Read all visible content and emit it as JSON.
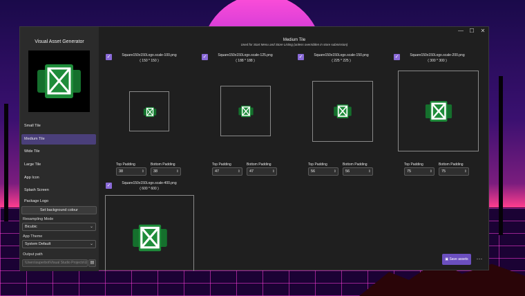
{
  "app": {
    "title": "Visual Asset Generator"
  },
  "window_controls": {
    "minimize": "—",
    "maximize": "☐",
    "close": "✕"
  },
  "sidebar": {
    "items": [
      {
        "label": "Small Tile"
      },
      {
        "label": "Medium Tile"
      },
      {
        "label": "Wide Tile"
      },
      {
        "label": "Large Tile"
      },
      {
        "label": "App Icon"
      },
      {
        "label": "Splash Screen"
      },
      {
        "label": "Package Logo"
      }
    ],
    "selected_index": 1,
    "background_button": "Set background colour",
    "resampling_label": "Resampling Mode",
    "resampling_value": "Bicubic",
    "theme_label": "App Theme",
    "theme_value": "System Default",
    "output_label": "Output path",
    "output_value": "\\Users\\superbot\\Visual Studio Projects\\Un",
    "folder_icon": "folder-icon"
  },
  "header": {
    "title": "Medium Tile",
    "subtitle": "Used for Start Menu and Store Listing (unless overridden in store submission)"
  },
  "labels": {
    "top_padding": "Top Padding",
    "bottom_padding": "Bottom Padding"
  },
  "assets": [
    {
      "file": "Square150x150Logo.scale-100.png",
      "dims": "( 150 * 150 )",
      "top": "38",
      "bottom": "38"
    },
    {
      "file": "Square150x150Logo.scale-125.png",
      "dims": "( 188 * 188 )",
      "top": "47",
      "bottom": "47"
    },
    {
      "file": "Square150x150Logo.scale-150.png",
      "dims": "( 225 * 225 )",
      "top": "56",
      "bottom": "56"
    },
    {
      "file": "Square150x150Logo.scale-200.png",
      "dims": "( 300 * 300 )",
      "top": "75",
      "bottom": "75"
    },
    {
      "file": "Square150x150Logo.scale-400.png",
      "dims": "( 600 * 600 )"
    }
  ],
  "actions": {
    "save": "Save assets",
    "more": "···"
  },
  "colors": {
    "accent": "#6b4fbf",
    "logo_green": "#1e8c3a",
    "logo_dark": "#15702d"
  }
}
